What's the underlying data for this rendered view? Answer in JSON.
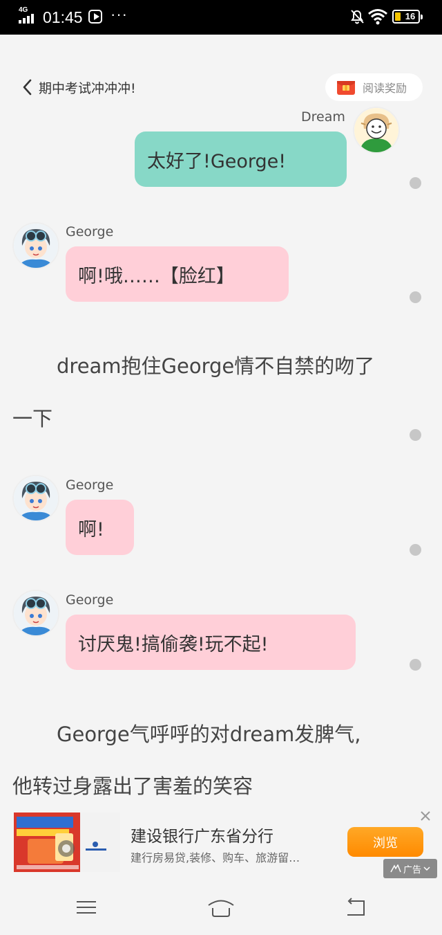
{
  "status_bar": {
    "network": "4G",
    "time": "01:45",
    "more": "···",
    "battery": "16"
  },
  "header": {
    "back_title": "期中考试冲冲冲!",
    "reward_label": "阅读奖励"
  },
  "messages": [
    {
      "sender": "Dream",
      "text": "太好了!George!"
    },
    {
      "sender": "George",
      "text": "啊!哦……【脸红】"
    },
    {
      "narration": [
        "dream抱住George情不自禁的吻了",
        "一下"
      ]
    },
    {
      "sender": "George",
      "text": "啊!"
    },
    {
      "sender": "George",
      "text": "讨厌鬼!搞偷袭!玩不起!"
    },
    {
      "narration": [
        "George气呼呼的对dream发脾气,",
        "他转过身露出了害羞的笑容"
      ]
    }
  ],
  "ad": {
    "title": "建设银行广东省分行",
    "description": "建行房易贷,装修、购车、旅游留…",
    "button": "浏览",
    "tag": "广告"
  },
  "colors": {
    "bubble_self": "#87d8c7",
    "bubble_other": "#ffcfd8",
    "ad_button": "#ff9500"
  },
  "icons": [
    "play-icon",
    "bell-muted-icon",
    "wifi-icon",
    "battery-icon",
    "back-chevron-icon",
    "red-envelope-icon",
    "close-icon",
    "menu-icon",
    "home-icon",
    "back-icon"
  ]
}
